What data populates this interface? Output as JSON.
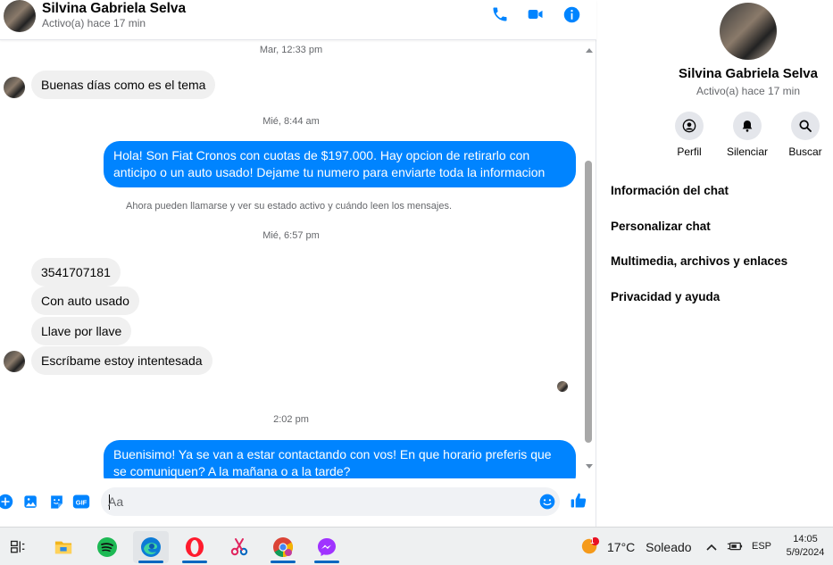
{
  "header": {
    "contact_name": "Silvina Gabriela Selva",
    "status": "Activo(a) hace 17 min"
  },
  "messages": {
    "ts1": "Mar, 12:33 pm",
    "m1": "Buenas días como es el tema",
    "ts2": "Mié, 8:44 am",
    "m2": "Hola! Son Fiat Cronos con cuotas de $197.000. Hay opcion de retirarlo con anticipo o un auto usado! Dejame tu numero para enviarte toda la informacion",
    "notice": "Ahora pueden llamarse y ver su estado activo y cuándo leen los mensajes.",
    "ts3": "Mié, 6:57 pm",
    "m3": "3541707181",
    "m4": "Con auto usado",
    "m5": "Llave por llave",
    "m6": "Escríbame estoy intentesada",
    "ts4": "2:02 pm",
    "m7": "Buenisimo! Ya se van a estar contactando con vos! En que horario preferis que se comuniquen? A la mañana o a la tarde?"
  },
  "composer": {
    "placeholder": "Aa",
    "gif_label": "GIF"
  },
  "side": {
    "name": "Silvina Gabriela Selva",
    "status": "Activo(a) hace 17 min",
    "actions": [
      {
        "label": "Perfil",
        "icon": "profile-icon"
      },
      {
        "label": "Silenciar",
        "icon": "bell-icon"
      },
      {
        "label": "Buscar",
        "icon": "search-icon"
      }
    ],
    "items": [
      "Información del chat",
      "Personalizar chat",
      "Multimedia, archivos y enlaces",
      "Privacidad y ayuda"
    ]
  },
  "taskbar": {
    "weather_temp": "17°C",
    "weather_desc": "Soleado",
    "weather_badge": "1",
    "lang": "ESP",
    "time": "14:05",
    "date": "5/9/2024"
  },
  "colors": {
    "accent": "#0084ff",
    "incoming_bubble": "#f0f0f0",
    "taskbar": "#eef0f1"
  }
}
